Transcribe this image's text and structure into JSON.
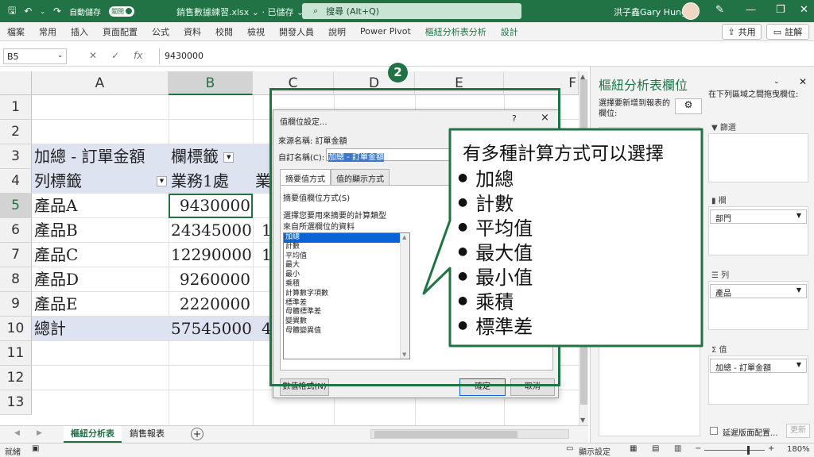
{
  "titlebar": {
    "autosave_label": "自動儲存",
    "autosave_state": "關閉",
    "file_name": "銷售數據練習.xlsx",
    "save_status": "已儲存",
    "search_placeholder": "搜尋 (Alt+Q)",
    "user_name": "洪子鑫Gary Hung"
  },
  "ribbon": {
    "tabs": [
      "檔案",
      "常用",
      "插入",
      "頁面配置",
      "公式",
      "資料",
      "校閱",
      "檢視",
      "開發人員",
      "說明",
      "Power Pivot",
      "樞紐分析表分析",
      "設計"
    ],
    "share_label": "共用",
    "comment_label": "註解"
  },
  "formula_bar": {
    "name_box": "B5",
    "fx": "fx",
    "value": "9430000"
  },
  "grid": {
    "columns": [
      "A",
      "B",
      "C",
      "D",
      "E",
      "F"
    ],
    "rows": [
      "1",
      "2",
      "3",
      "4",
      "5",
      "6",
      "7",
      "8",
      "9",
      "10",
      "11",
      "12",
      "13"
    ],
    "r3": {
      "a": "加總 - 訂單金額",
      "b": "欄標籤"
    },
    "r4": {
      "a": "列標籤",
      "b": "業務1處",
      "c": "業"
    },
    "data_rows": [
      {
        "label": "產品A",
        "value": "9430000",
        "c": ""
      },
      {
        "label": "產品B",
        "value": "24345000",
        "c": "1"
      },
      {
        "label": "產品C",
        "value": "12290000",
        "c": "1"
      },
      {
        "label": "產品D",
        "value": "9260000",
        "c": ""
      },
      {
        "label": "產品E",
        "value": "2220000",
        "c": ""
      }
    ],
    "total": {
      "label": "總計",
      "value": "57545000",
      "c": "4"
    }
  },
  "sheets": {
    "tabs": [
      "樞紐分析表",
      "銷售報表"
    ],
    "add_label": "+"
  },
  "status": {
    "ready": "就緒",
    "display_settings": "顯示設定",
    "zoom": "180%",
    "zoom_minus": "−",
    "zoom_plus": "+"
  },
  "pivot_pane": {
    "title": "樞紐分析表欄位",
    "choose_fields": "選擇要新增到報表的欄位:",
    "drag_hint": "在下列區域之間拖曳欄位:",
    "filter_label": "篩選",
    "columns_label": "欄",
    "columns_chip": "部門",
    "rows_label": "列",
    "rows_chip": "產品",
    "values_label": "值",
    "values_chip": "加總 - 訂單金額",
    "defer_label": "延遲版面配置...",
    "update_label": "更新"
  },
  "dialog": {
    "title": "值欄位設定...",
    "help": "?",
    "close": "×",
    "source_label": "來源名稱:",
    "source_value": "訂單金額",
    "custom_label": "自訂名稱(C):",
    "custom_value": "加總 - 訂單金額",
    "tabs": [
      "摘要值方式",
      "值的顯示方式"
    ],
    "summarize_by": "摘要值欄位方式(S)",
    "desc1": "選擇您要用來摘要的計算類型",
    "desc2": "來自所選欄位的資料",
    "functions": [
      "加總",
      "計數",
      "平均值",
      "最大",
      "最小",
      "乘積",
      "計算數字項數",
      "標準差",
      "母體標準差",
      "變異數",
      "母體變異值"
    ],
    "number_format": "數值格式(N)",
    "ok": "確定",
    "cancel": "取消"
  },
  "callout": {
    "step": "2",
    "heading": "有多種計算方式可以選擇",
    "items": [
      "加總",
      "計數",
      "平均值",
      "最大值",
      "最小值",
      "乘積",
      "標準差"
    ]
  },
  "colors": {
    "accent": "#217346",
    "pivot_band": "#dde3f0"
  }
}
